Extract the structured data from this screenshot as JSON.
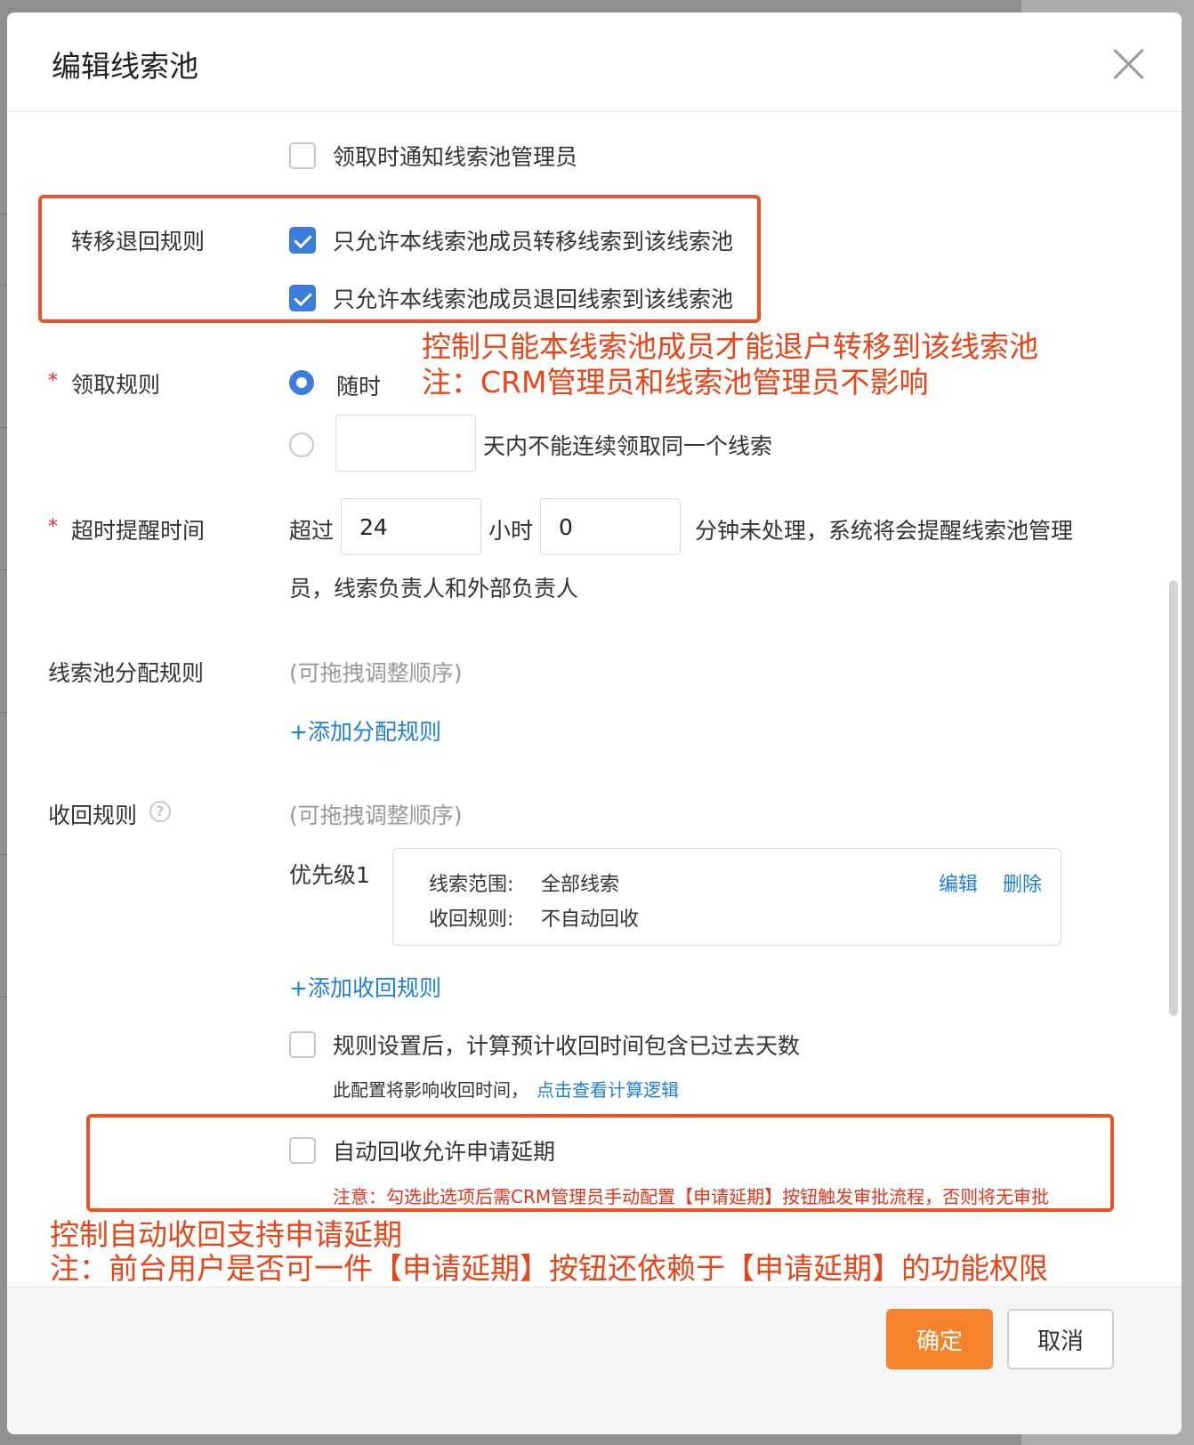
{
  "dialog": {
    "title": "编辑线索池"
  },
  "notify_admin": {
    "label": "领取时通知线索池管理员",
    "checked": false
  },
  "transfer_rules": {
    "label": "转移退回规则",
    "option_transfer": "只允许本线索池成员转移线索到该线索池",
    "option_return": "只允许本线索池成员退回线索到该线索池"
  },
  "annotation_top": {
    "line1": "控制只能本线索池成员才能退户转移到该线索池",
    "line2": "注：CRM管理员和线索池管理员不影响"
  },
  "claim_rules": {
    "required_mark": "*",
    "label": "领取规则",
    "option_anytime": "随时",
    "days_value": "",
    "option_days_suffix": "天内不能连续领取同一个线索"
  },
  "timeout_reminder": {
    "required_mark": "*",
    "label": "超时提醒时间",
    "prefix": "超过",
    "hours_value": "24",
    "hours_unit": "小时",
    "minutes_value": "0",
    "suffix_line1": "分钟未处理，系统将会提醒线索池管理",
    "suffix_line2": "员，线索负责人和外部负责人"
  },
  "assign_rules": {
    "label": "线索池分配规则",
    "hint": "(可拖拽调整顺序)",
    "add_link": "+添加分配规则"
  },
  "recycle_rules": {
    "label": "收回规则",
    "help_icon": "question-circle-icon",
    "hint": "(可拖拽调整顺序)",
    "priority_label": "优先级1",
    "card": {
      "scope_label": "线索范围:",
      "scope_value": "全部线索",
      "rule_label": "收回规则:",
      "rule_value": "不自动回收",
      "edit": "编辑",
      "delete": "删除"
    },
    "add_link": "+添加收回规则",
    "include_past_days_label": "规则设置后，计算预计收回时间包含已过去天数",
    "include_past_days_note": "此配置将影响收回时间，",
    "include_past_days_link": "点击查看计算逻辑",
    "allow_extension_label": "自动回收允许申请延期",
    "allow_extension_warning": "注意：勾选此选项后需CRM管理员手动配置【申请延期】按钮触发审批流程，否则将无审批"
  },
  "annotation_bottom": {
    "line1": "控制自动收回支持申请延期",
    "line2": "注：前台用户是否可一件【申请延期】按钮还依赖于【申请延期】的功能权限"
  },
  "footer": {
    "ok": "确定",
    "cancel": "取消"
  },
  "colors": {
    "primary": "#3a7ddc",
    "link": "#1e7fe0",
    "ok_button": "#f5832b",
    "annotation_red": "#ec4417",
    "required_red": "#f5222d"
  }
}
